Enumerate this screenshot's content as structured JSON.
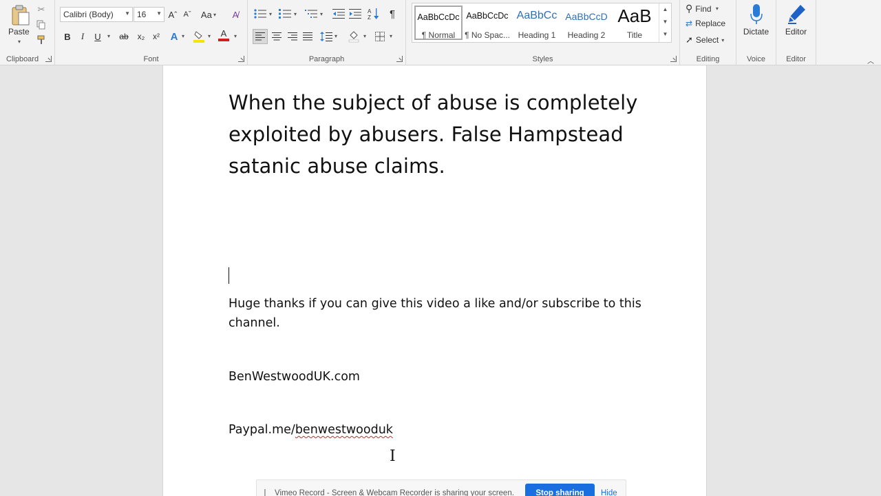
{
  "ribbon": {
    "clipboard": {
      "label": "Clipboard",
      "paste": "Paste",
      "icons": [
        "paste-icon",
        "cut-icon",
        "copy-icon",
        "format-painter-icon"
      ]
    },
    "font": {
      "label": "Font",
      "font_name": "Calibri (Body)",
      "font_size": "16",
      "grow": "Aˆ",
      "shrink": "Aˇ",
      "change_case": "Aa",
      "bold": "B",
      "italic": "I",
      "underline": "U",
      "strike": "ab",
      "subscript": "x₂",
      "superscript": "x²",
      "text_effects": "A",
      "highlight_color": "#f5e400",
      "font_color": "#d41e1e",
      "font_color_glyph": "A"
    },
    "paragraph": {
      "label": "Paragraph",
      "pilcrow": "¶"
    },
    "styles": {
      "label": "Styles",
      "items": [
        {
          "preview": "AaBbCcDc",
          "name": "¶ Normal"
        },
        {
          "preview": "AaBbCcDc",
          "name": "¶ No Spac..."
        },
        {
          "preview": "AaBbCc",
          "name": "Heading 1"
        },
        {
          "preview": "AaBbCcD",
          "name": "Heading 2"
        },
        {
          "preview": "AaB",
          "name": "Title"
        }
      ]
    },
    "editing": {
      "label": "Editing",
      "find": "Find",
      "replace": "Replace",
      "select": "Select"
    },
    "voice": {
      "label": "Voice",
      "dictate": "Dictate"
    },
    "editor": {
      "label": "Editor",
      "editor": "Editor"
    }
  },
  "document": {
    "title": "When the subject of abuse is completely exploited by abusers. False Hampstead satanic abuse claims.",
    "paragraph_1": "Huge thanks if you can give this video a like and/or subscribe to this channel.",
    "website": "BenWestwoodUK.com",
    "paypal_prefix": "Paypal.me/",
    "paypal_handle": "benwestwooduk"
  },
  "share_bar": {
    "message": "Vimeo Record - Screen & Webcam Recorder is sharing your screen.",
    "stop": "Stop sharing",
    "hide": "Hide"
  },
  "colors": {
    "accent": "#1a6fe0",
    "editor_pen": "#1e62c8",
    "dictate_mic": "#2a7bd6"
  }
}
